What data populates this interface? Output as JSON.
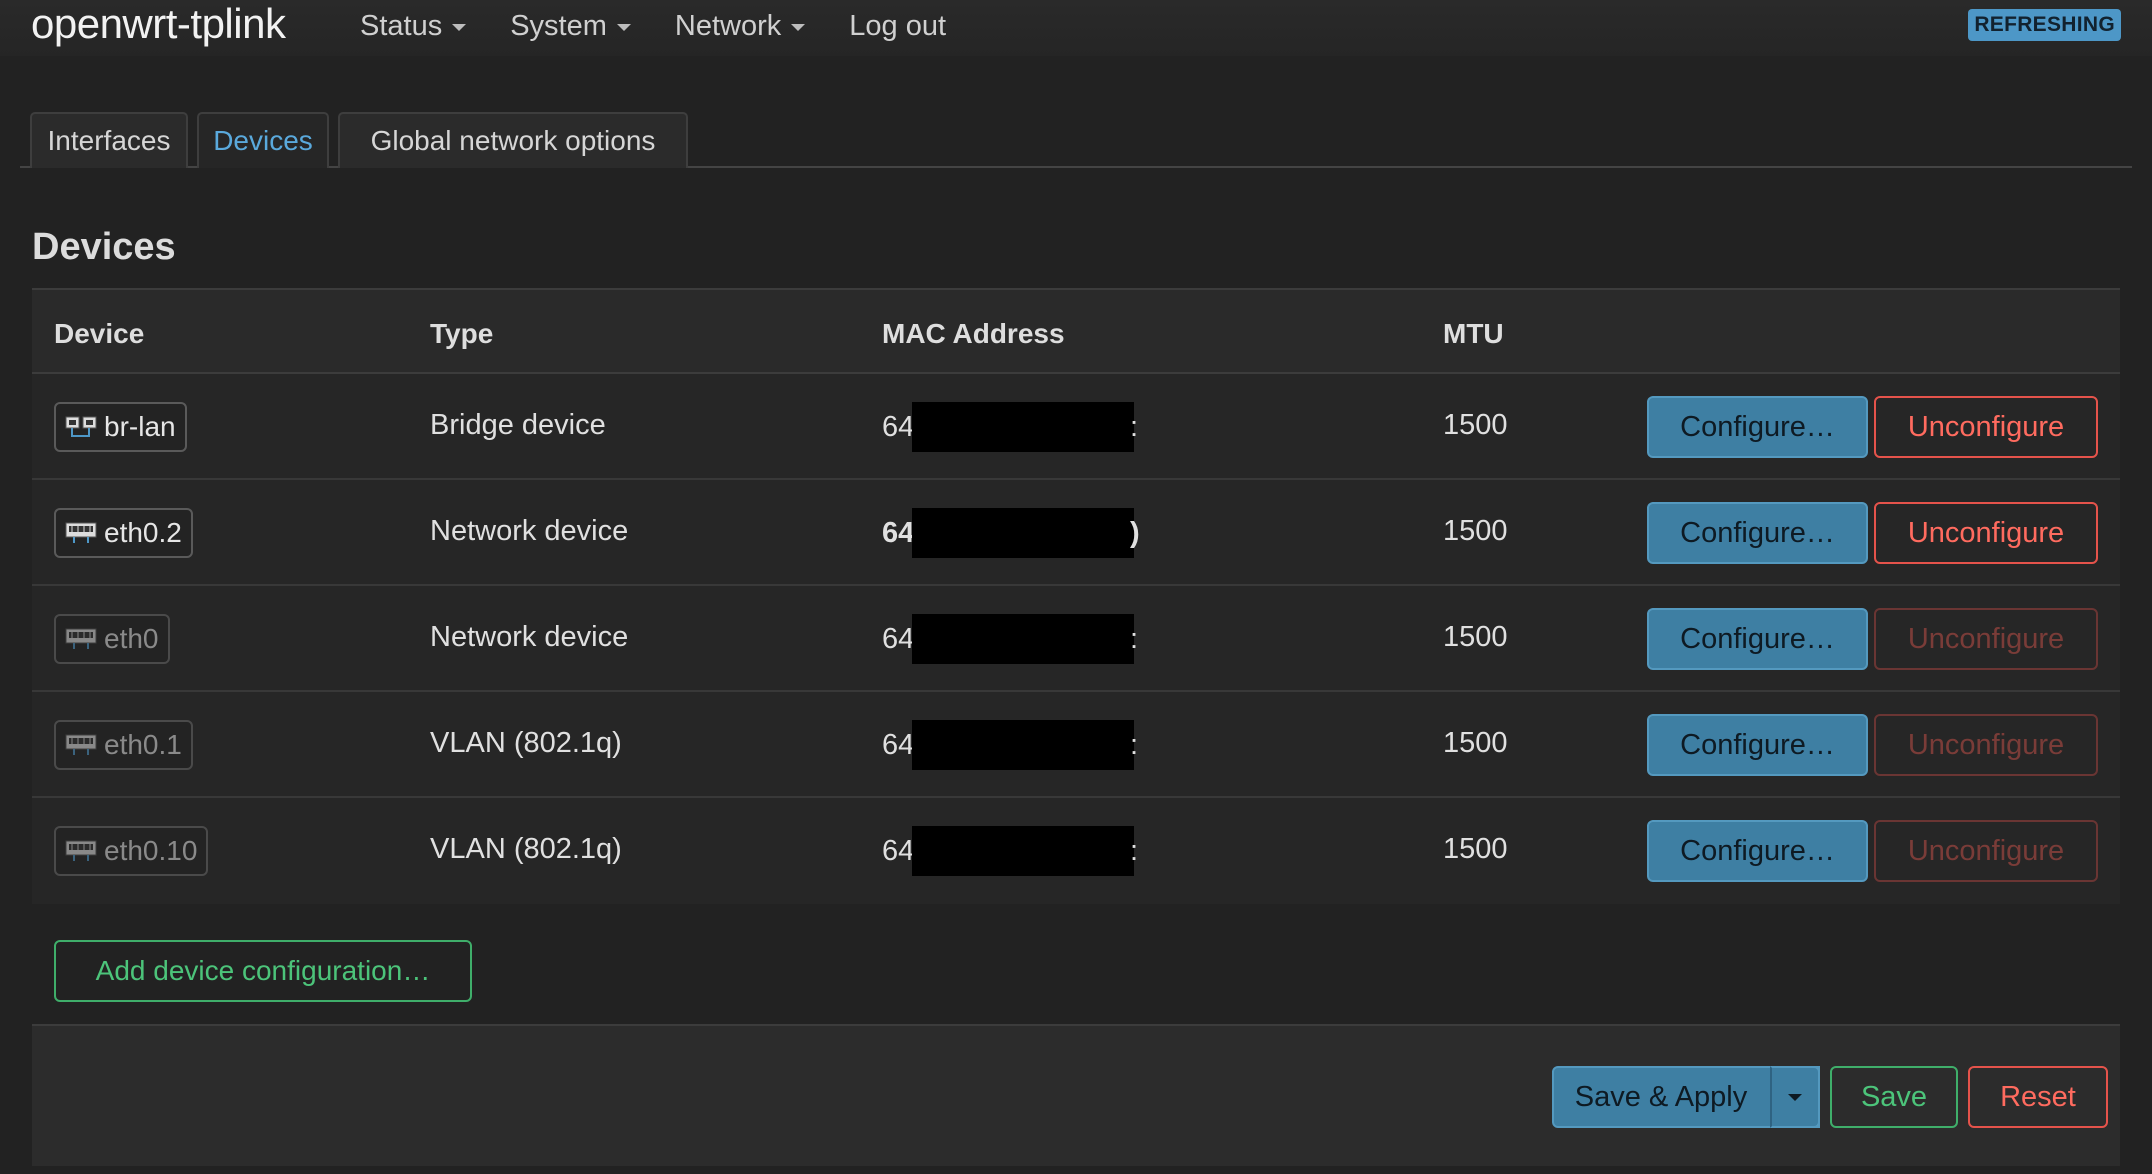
{
  "header": {
    "brand": "openwrt-tplink",
    "menu": [
      {
        "label": "Status",
        "has_caret": true
      },
      {
        "label": "System",
        "has_caret": true
      },
      {
        "label": "Network",
        "has_caret": true
      },
      {
        "label": "Log out",
        "has_caret": false
      }
    ],
    "status_badge": "REFRESHING"
  },
  "tabs": [
    {
      "label": "Interfaces",
      "active": false
    },
    {
      "label": "Devices",
      "active": true
    },
    {
      "label": "Global network options",
      "active": false
    }
  ],
  "section_title": "Devices",
  "table": {
    "columns": [
      "Device",
      "Type",
      "MAC Address",
      "MTU"
    ],
    "rows": [
      {
        "device": "br-lan",
        "icon": "bridge-icon",
        "dim": false,
        "type": "Bridge device",
        "mac_prefix": "64",
        "mac_tail": ":",
        "mac_bold": false,
        "mtu": "1500",
        "configure": "Configure…",
        "unconfigure": "Unconfigure",
        "unconfigure_enabled": true
      },
      {
        "device": "eth0.2",
        "icon": "ethernet-port-icon",
        "dim": false,
        "type": "Network device",
        "mac_prefix": "64",
        "mac_tail": ")",
        "mac_bold": true,
        "mtu": "1500",
        "configure": "Configure…",
        "unconfigure": "Unconfigure",
        "unconfigure_enabled": true
      },
      {
        "device": "eth0",
        "icon": "ethernet-port-icon",
        "dim": true,
        "type": "Network device",
        "mac_prefix": "64",
        "mac_tail": ":",
        "mac_bold": false,
        "mtu": "1500",
        "configure": "Configure…",
        "unconfigure": "Unconfigure",
        "unconfigure_enabled": false
      },
      {
        "device": "eth0.1",
        "icon": "ethernet-port-icon",
        "dim": true,
        "type": "VLAN (802.1q)",
        "mac_prefix": "64",
        "mac_tail": ":",
        "mac_bold": false,
        "mtu": "1500",
        "configure": "Configure…",
        "unconfigure": "Unconfigure",
        "unconfigure_enabled": false
      },
      {
        "device": "eth0.10",
        "icon": "ethernet-port-icon",
        "dim": true,
        "type": "VLAN (802.1q)",
        "mac_prefix": "64",
        "mac_tail": ":",
        "mac_bold": false,
        "mtu": "1500",
        "configure": "Configure…",
        "unconfigure": "Unconfigure",
        "unconfigure_enabled": false
      }
    ]
  },
  "add_device_label": "Add device configuration…",
  "footer": {
    "save_apply": "Save & Apply",
    "save": "Save",
    "reset": "Reset"
  },
  "colors": {
    "background": "#222222",
    "accent_blue": "#3e7fa3",
    "success_green": "#3fae6a",
    "danger_red": "#e5534b"
  }
}
